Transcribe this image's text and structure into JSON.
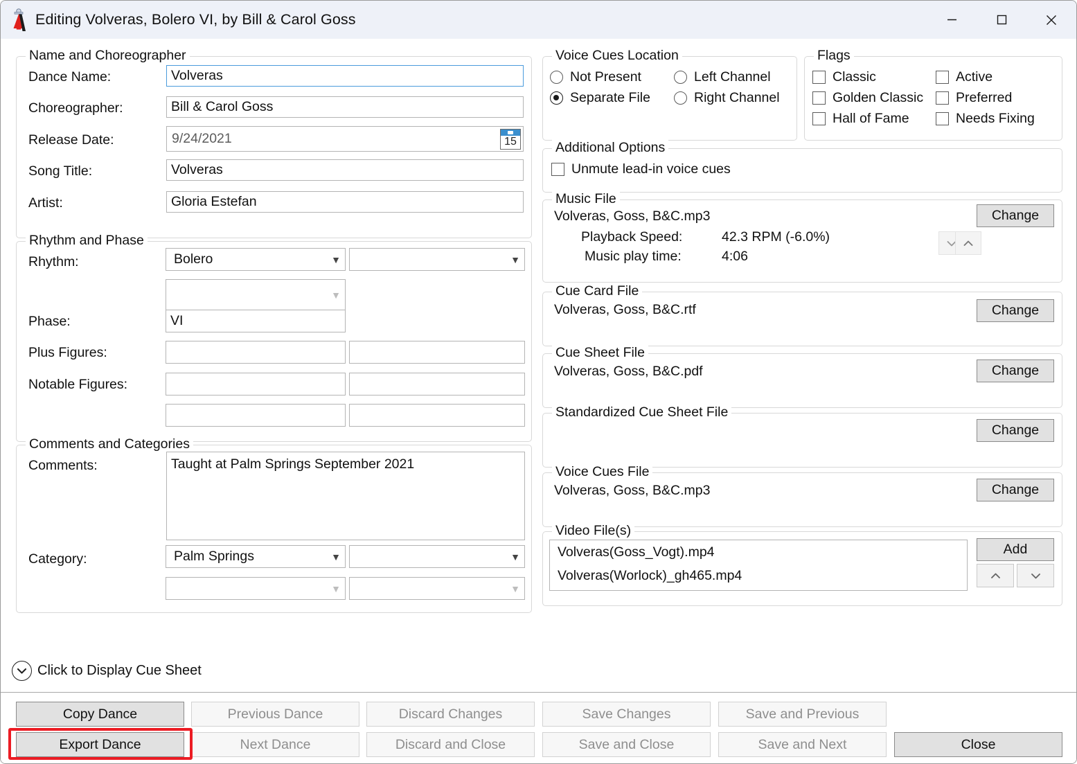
{
  "window": {
    "title": "Editing Volveras, Bolero VI, by Bill & Carol Goss",
    "app_icon": "dancer-dress-icon",
    "controls": {
      "minimize": "—",
      "maximize": "☐",
      "close": "✕"
    }
  },
  "name_group": {
    "legend": "Name and Choreographer",
    "fields": [
      {
        "label": "Dance Name:",
        "value": "Volveras",
        "focused": true
      },
      {
        "label": "Choreographer:",
        "value": "Bill & Carol Goss",
        "focused": false
      },
      {
        "label": "Release Date:",
        "value": "9/24/2021",
        "focused": false
      },
      {
        "label": "Song Title:",
        "value": "Volveras",
        "focused": false
      },
      {
        "label": "Artist:",
        "value": "Gloria Estefan",
        "focused": false
      }
    ],
    "calendar_day": "15"
  },
  "rhythm_group": {
    "legend": "Rhythm and Phase",
    "rhythm_label": "Rhythm:",
    "rhythm_value": "Bolero",
    "rhythm_second": "",
    "rhythm_third": "",
    "phase_label": "Phase:",
    "phase_value": "VI",
    "plus_label": "Plus Figures:",
    "plus_value_1": "",
    "plus_value_2": "",
    "notable_label": "Notable Figures:",
    "notable_value_1": "",
    "notable_value_2": "",
    "notable_value_3": "",
    "notable_value_4": ""
  },
  "comments_group": {
    "legend": "Comments and Categories",
    "comments_label": "Comments:",
    "comments_value": "Taught at Palm Springs September 2021",
    "category_label": "Category:",
    "category_1": "Palm Springs",
    "category_2": "",
    "category_3": "",
    "category_4": ""
  },
  "expander": {
    "label": "Click to Display Cue Sheet",
    "icon": "chevron-down-circle-icon"
  },
  "voice_cues_location": {
    "legend": "Voice Cues Location",
    "options": [
      {
        "label": "Not Present",
        "selected": false
      },
      {
        "label": "Left Channel",
        "selected": false
      },
      {
        "label": "Separate File",
        "selected": true
      },
      {
        "label": "Right Channel",
        "selected": false
      }
    ]
  },
  "flags": {
    "legend": "Flags",
    "items": [
      {
        "label": "Classic",
        "checked": false
      },
      {
        "label": "Active",
        "checked": false
      },
      {
        "label": "Golden Classic",
        "checked": false
      },
      {
        "label": "Preferred",
        "checked": false
      },
      {
        "label": "Hall of Fame",
        "checked": false
      },
      {
        "label": "Needs Fixing",
        "checked": false
      }
    ]
  },
  "additional_options": {
    "legend": "Additional Options",
    "unmute_label": "Unmute lead-in voice cues",
    "unmute_checked": false
  },
  "music_file": {
    "legend": "Music File",
    "filename": "Volveras, Goss, B&C.mp3",
    "playback_speed_label": "Playback Speed:",
    "playback_speed_value": "42.3 RPM (-6.0%)",
    "play_time_label": "Music play time:",
    "play_time_value": "4:06",
    "change_label": "Change",
    "spin_down": "˅",
    "spin_up": "˄"
  },
  "cue_card_file": {
    "legend": "Cue Card File",
    "filename": "Volveras, Goss, B&C.rtf",
    "change_label": "Change"
  },
  "cue_sheet_file": {
    "legend": "Cue Sheet File",
    "filename": "Volveras, Goss, B&C.pdf",
    "change_label": "Change"
  },
  "standardized_cue_sheet_file": {
    "legend": "Standardized Cue Sheet File",
    "filename": "",
    "change_label": "Change"
  },
  "voice_cues_file": {
    "legend": "Voice Cues File",
    "filename": "Volveras, Goss, B&C.mp3",
    "change_label": "Change"
  },
  "video_files": {
    "legend": "Video File(s)",
    "items": [
      "Volveras(Goss_Vogt).mp4",
      "Volveras(Worlock)_gh465.mp4"
    ],
    "add_label": "Add",
    "move_up": "˄",
    "move_down": "˅"
  },
  "bottom_buttons": {
    "row1": [
      {
        "label": "Copy Dance",
        "enabled": true
      },
      {
        "label": "Previous Dance",
        "enabled": false
      },
      {
        "label": "Discard Changes",
        "enabled": false
      },
      {
        "label": "Save Changes",
        "enabled": false
      },
      {
        "label": "Save and Previous",
        "enabled": false
      }
    ],
    "row2": [
      {
        "label": "Export Dance",
        "enabled": true,
        "highlighted": true
      },
      {
        "label": "Next Dance",
        "enabled": false
      },
      {
        "label": "Discard and Close",
        "enabled": false
      },
      {
        "label": "Save and Close",
        "enabled": false
      },
      {
        "label": "Save and Next",
        "enabled": false
      },
      {
        "label": "Close",
        "enabled": true
      }
    ]
  },
  "colors": {
    "titlebar": "#eef1f8",
    "highlight": "#ec1c24",
    "focus_border": "#4a9bdc",
    "button_face": "#e1e1e1",
    "calendar_header": "#3a8fce"
  }
}
